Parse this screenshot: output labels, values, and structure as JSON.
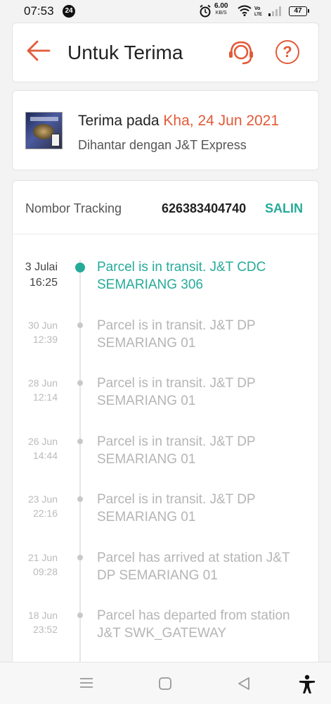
{
  "status_bar": {
    "time": "07:53",
    "notification_count": "24",
    "net_speed": "6.00",
    "net_unit": "KB/S",
    "battery": "47"
  },
  "header": {
    "title": "Untuk Terima",
    "accent_color": "#e25a38"
  },
  "delivery": {
    "received_prefix": "Terima pada",
    "received_date": "Kha, 24 Jun 2021",
    "shipped_via": "Dihantar dengan J&T Express"
  },
  "tracking": {
    "label": "Nombor Tracking",
    "number": "626383404740",
    "copy_label": "SALIN",
    "active_color": "#26aa99"
  },
  "events": [
    {
      "date": "3 Julai",
      "time": "16:25",
      "text": "Parcel is in transit. J&T CDC SEMARIANG 306",
      "active": true
    },
    {
      "date": "30 Jun",
      "time": "12:39",
      "text": "Parcel is in transit. J&T DP SEMARIANG 01",
      "active": false
    },
    {
      "date": "28 Jun",
      "time": "12:14",
      "text": "Parcel is in transit. J&T DP SEMARIANG 01",
      "active": false
    },
    {
      "date": "26 Jun",
      "time": "14:44",
      "text": "Parcel is in transit. J&T DP SEMARIANG 01",
      "active": false
    },
    {
      "date": "23 Jun",
      "time": "22:16",
      "text": "Parcel is in transit. J&T DP SEMARIANG 01",
      "active": false
    },
    {
      "date": "21 Jun",
      "time": "09:28",
      "text": "Parcel has arrived at station J&T DP SEMARIANG 01",
      "active": false
    },
    {
      "date": "18 Jun",
      "time": "23:52",
      "text": "Parcel has departed from station J&T SWK_GATEWAY",
      "active": false
    }
  ],
  "navbar": {
    "icons": [
      "menu-icon",
      "home-icon",
      "back-icon",
      "accessibility-icon"
    ]
  }
}
